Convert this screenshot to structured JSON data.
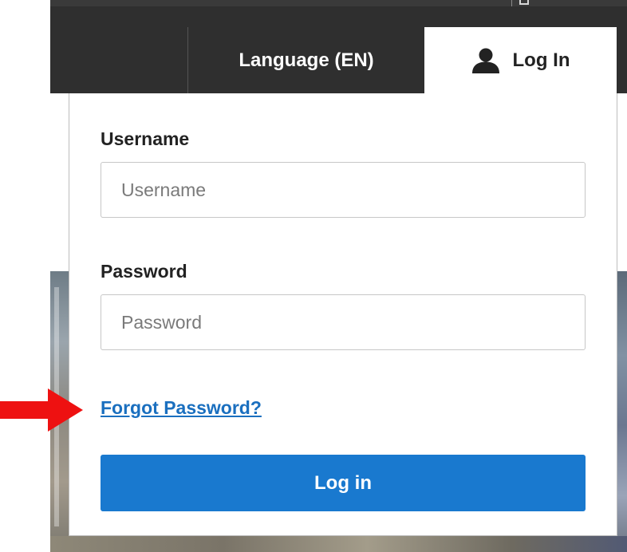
{
  "nav": {
    "language_label": "Language (EN)",
    "login_tab_label": "Log In"
  },
  "form": {
    "username_label": "Username",
    "username_placeholder": "Username",
    "username_value": "",
    "password_label": "Password",
    "password_placeholder": "Password",
    "password_value": "",
    "forgot_link": "Forgot Password?",
    "submit_label": "Log in"
  },
  "icons": {
    "login_tab_icon": "user-icon",
    "annotation": "red-arrow-icon"
  },
  "colors": {
    "navbar_bg": "#2f2f2f",
    "primary_button": "#1979cf",
    "link": "#1a6fbf",
    "annotation_arrow": "#ee1111"
  }
}
